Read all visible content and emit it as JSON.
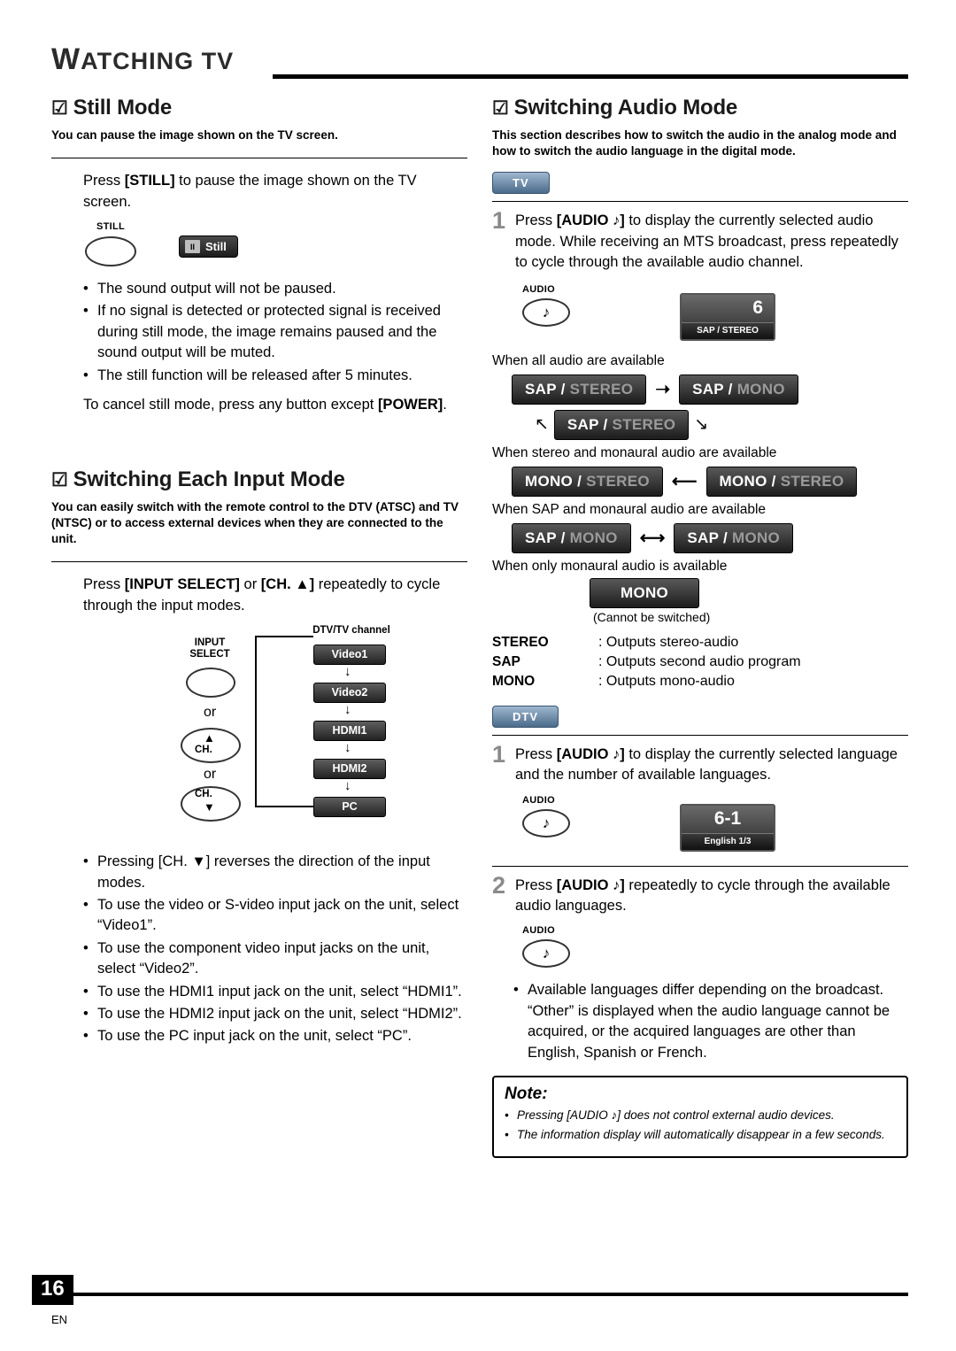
{
  "header": {
    "title_cap": "W",
    "title_rest": "ATCHING TV"
  },
  "left": {
    "still": {
      "heading": "Still Mode",
      "lead": "You can pause the image shown on the TV screen.",
      "body1_pre": "Press ",
      "body1_key": "[STILL]",
      "body1_post": " to pause the image shown on the TV screen.",
      "button_label": "STILL",
      "osd_pill_icon": "II",
      "osd_pill_text": "Still",
      "bullets": [
        "The sound output will not be paused.",
        "If no signal is detected or protected signal is received during still mode, the image remains paused and the sound output will be muted.",
        "The still function will be released after 5 minutes."
      ],
      "cancel_pre": "To cancel still mode, press any button except ",
      "cancel_key": "[POWER]",
      "cancel_post": "."
    },
    "switch_input": {
      "heading": "Switching Each Input Mode",
      "lead": "You can easily switch with the remote control to the DTV (ATSC) and TV (NTSC) or to access external devices when they are connected to the unit.",
      "body_pre": "Press ",
      "body_key1": "[INPUT SELECT]",
      "body_mid": " or ",
      "body_key2": "[CH. ▲]",
      "body_post": " repeatedly to cycle through the input modes.",
      "diagram": {
        "input_select_label": "INPUT\nSELECT",
        "or1": "or",
        "ch_up_label": "CH.",
        "or2": "or",
        "ch_down_label": "CH.",
        "channel_label": "DTV/TV channel",
        "items": [
          "Video1",
          "Video2",
          "HDMI1",
          "HDMI2",
          "PC"
        ]
      },
      "bullets": [
        "Pressing [CH. ▼] reverses the direction of the input modes.",
        "To use the video or S-video input jack on the unit, select “Video1”.",
        "To use the component video input jacks on the unit, select “Video2”.",
        "To use the HDMI1 input jack on the unit, select “HDMI1”.",
        "To use the HDMI2 input jack on the unit, select “HDMI2”.",
        "To use the PC input jack on the unit, select “PC”."
      ]
    }
  },
  "right": {
    "heading": "Switching Audio Mode",
    "lead": "This section describes how to switch the audio in the analog mode and how to switch the audio language in the digital mode.",
    "tv_tab": "TV",
    "dtv_tab": "DTV",
    "tv_step": {
      "n": "1",
      "pre": "Press ",
      "key": "[AUDIO ♪]",
      "post": " to display the currently selected audio mode. While receiving an MTS broadcast, press repeatedly to cycle through the available audio channel."
    },
    "tv_button_label": "AUDIO",
    "tv_osd": {
      "num": "6",
      "sub": "SAP / STEREO"
    },
    "cases": [
      {
        "caption": "When all audio are available",
        "kind": "triple",
        "badges": [
          {
            "strong": "SAP /",
            "dim": " STEREO"
          },
          {
            "strong": "SAP /",
            "dim": " MONO"
          },
          {
            "strong": "SAP /",
            "dim": " STEREO"
          }
        ]
      },
      {
        "caption": "When stereo and monaural audio are available",
        "kind": "pair",
        "badges": [
          {
            "strong": "MONO /",
            "dim": " STEREO"
          },
          {
            "strong": "MONO /",
            "dim": " STEREO"
          }
        ]
      },
      {
        "caption": "When SAP and monaural audio are available",
        "kind": "pair",
        "badges": [
          {
            "strong": "SAP /",
            "dim": " MONO"
          },
          {
            "strong": "SAP /",
            "dim": " MONO"
          }
        ]
      },
      {
        "caption": "When only monaural audio is available",
        "kind": "single",
        "badges": [
          {
            "strong": "MONO",
            "dim": ""
          }
        ],
        "note": "(Cannot be switched)"
      }
    ],
    "defs": [
      {
        "k": "STEREO",
        "v": ": Outputs stereo-audio"
      },
      {
        "k": "SAP",
        "v": ": Outputs second audio program"
      },
      {
        "k": "MONO",
        "v": ": Outputs mono-audio"
      }
    ],
    "dtv_step1": {
      "n": "1",
      "pre": "Press ",
      "key": "[AUDIO ♪]",
      "post": " to display the currently selected language and the number of available languages."
    },
    "dtv_button_label": "AUDIO",
    "dtv_osd": {
      "num": "6-1",
      "sub": "English 1/3"
    },
    "dtv_step2": {
      "n": "2",
      "pre": "Press ",
      "key": "[AUDIO ♪]",
      "post": " repeatedly to cycle through the available audio languages."
    },
    "dtv_button_label2": "AUDIO",
    "dtv_bullets": [
      "Available languages differ depending on the broadcast. “Other” is displayed when the audio language cannot be acquired, or the acquired languages are other than English, Spanish or French."
    ],
    "note": {
      "title": "Note:",
      "items": [
        "Pressing [AUDIO ♪] does not control external audio devices.",
        "The information display will automatically disappear in a few seconds."
      ]
    }
  },
  "footer": {
    "page": "16",
    "lang": "EN"
  }
}
